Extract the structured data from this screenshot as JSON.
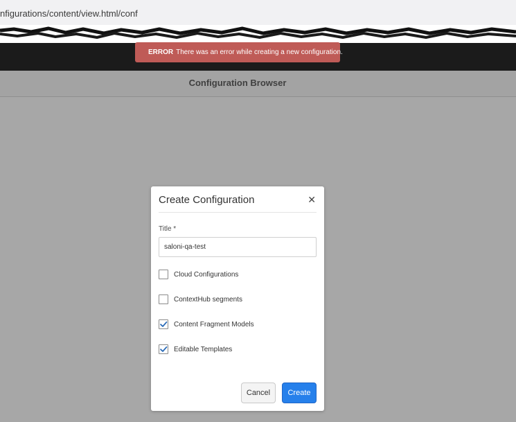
{
  "browser": {
    "url": "nfigurations/content/view.html/conf"
  },
  "toast": {
    "label": "ERROR",
    "message": "There was an error while creating a new configuration.",
    "icon": "warning-icon",
    "color": "#bf5b57"
  },
  "page": {
    "title": "Configuration Browser"
  },
  "dialog": {
    "title": "Create Configuration",
    "close_icon": "close-icon",
    "title_label": "Title *",
    "title_value": "saloni-qa-test",
    "options": [
      {
        "label": "Cloud Configurations",
        "checked": false
      },
      {
        "label": "ContextHub segments",
        "checked": false
      },
      {
        "label": "Content Fragment Models",
        "checked": true
      },
      {
        "label": "Editable Templates",
        "checked": true
      }
    ],
    "cancel_label": "Cancel",
    "create_label": "Create",
    "accent": "#2680eb"
  }
}
